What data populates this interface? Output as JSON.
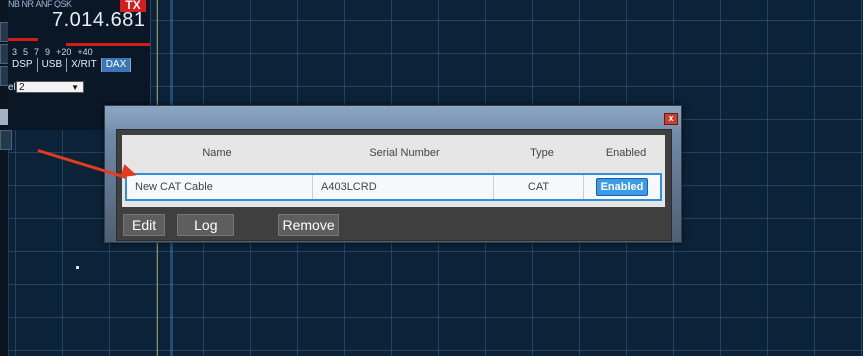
{
  "slice": {
    "flags": [
      "NB",
      "NR",
      "ANF",
      "QSK"
    ],
    "tx_label": "TX",
    "frequency": "7.014.681",
    "scale": [
      "3",
      "5",
      "7",
      "9",
      "+20",
      "+40"
    ],
    "modes": [
      {
        "label": "DSP",
        "active": false
      },
      {
        "label": "USB",
        "active": false
      },
      {
        "label": "X/RIT",
        "active": false
      },
      {
        "label": "DAX",
        "active": true
      }
    ],
    "channel_label": "el:",
    "channel_value": "2"
  },
  "dialog": {
    "close_label": "x",
    "columns": [
      "Name",
      "Serial Number",
      "Type",
      "Enabled"
    ],
    "rows": [
      {
        "name": "New CAT Cable",
        "serial": "A403LCRD",
        "type": "CAT",
        "enabled": "Enabled"
      }
    ],
    "buttons": {
      "edit": "Edit",
      "log": "Log",
      "remove": "Remove"
    }
  },
  "colors": {
    "accent": "#3b9be8",
    "tx": "#d41d1d",
    "annotation_arrow": "#e63a1e"
  }
}
